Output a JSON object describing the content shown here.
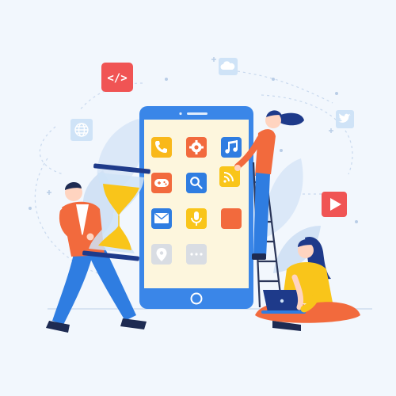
{
  "colors": {
    "background": "#f2f7fd",
    "phone_frame": "#3a86e8",
    "phone_screen": "#fdf6dd",
    "accent_orange": "#f26a3d",
    "accent_yellow": "#f9c51a",
    "accent_blue": "#2f7de1",
    "red_badge": "#f05454",
    "light_blue_tile": "#cfe3f7",
    "sand": "#f8d37a",
    "hair": "#1e2b52"
  },
  "phone": {
    "app_icons": [
      {
        "name": "phone-icon",
        "color": "#f9b81a"
      },
      {
        "name": "gear-icon",
        "color": "#f26a3d"
      },
      {
        "name": "music-icon",
        "color": "#2f7de1"
      },
      {
        "name": "gamepad-icon",
        "color": "#f26a3d"
      },
      {
        "name": "search-icon",
        "color": "#2f7de1"
      },
      {
        "name": "rss-icon",
        "color": "#f9c51a"
      },
      {
        "name": "mail-icon",
        "color": "#2f7de1"
      },
      {
        "name": "microphone-icon",
        "color": "#f9c51a"
      },
      {
        "name": "blank-app-icon",
        "color": "#f26a3d"
      },
      {
        "name": "location-pin-icon",
        "color": "#d9dde3"
      },
      {
        "name": "more-icon",
        "color": "#d9dde3"
      }
    ]
  },
  "floating_icons": [
    {
      "name": "code-icon",
      "color": "#f05454"
    },
    {
      "name": "cloud-icon",
      "color": "#cfe3f7"
    },
    {
      "name": "globe-icon",
      "color": "#cfe3f7"
    },
    {
      "name": "twitter-icon",
      "color": "#cfe3f7"
    },
    {
      "name": "play-icon",
      "color": "#f05454"
    }
  ],
  "code_icon_text": "</>"
}
